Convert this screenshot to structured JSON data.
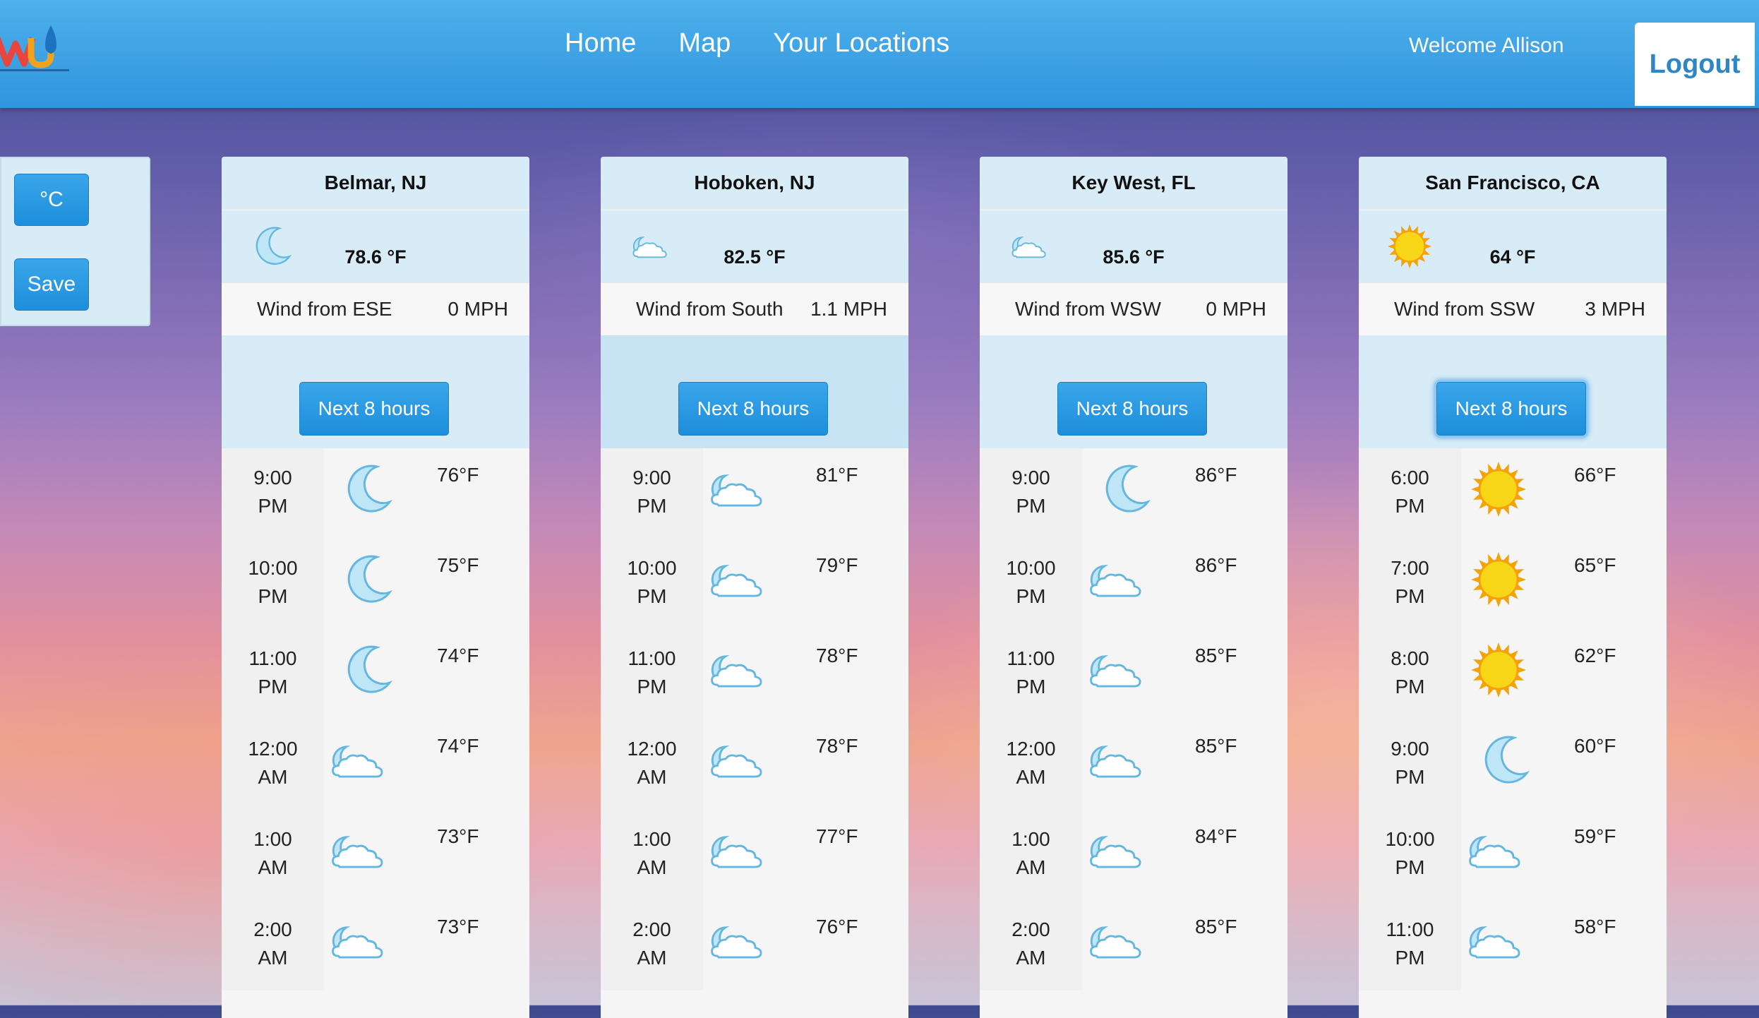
{
  "header": {
    "nav": [
      "Home",
      "Map",
      "Your Locations"
    ],
    "welcome": "Welcome Allison",
    "logout": "Logout"
  },
  "settings": {
    "unit_button": "°C",
    "save_button": "Save"
  },
  "colors": {
    "header": "#2f95dd",
    "button": "#1e8fdc",
    "card_panel": "#d8ecf7",
    "sun": "#f5c400",
    "moon": "#8fd0ee"
  },
  "cards": [
    {
      "title": "Belmar, NJ",
      "current_temp": "78.6 °F",
      "current_icon": "moon-icon",
      "wind_dir": "Wind from ESE",
      "wind_speed": "0 MPH",
      "button": "Next 8 hours",
      "hours": [
        {
          "time": "9:00 PM",
          "temp": "76°F",
          "icon": "moon-icon"
        },
        {
          "time": "10:00 PM",
          "temp": "75°F",
          "icon": "moon-icon"
        },
        {
          "time": "11:00 PM",
          "temp": "74°F",
          "icon": "moon-icon"
        },
        {
          "time": "12:00 AM",
          "temp": "74°F",
          "icon": "partly-cloudy-night-icon"
        },
        {
          "time": "1:00 AM",
          "temp": "73°F",
          "icon": "partly-cloudy-night-icon"
        },
        {
          "time": "2:00 AM",
          "temp": "73°F",
          "icon": "partly-cloudy-night-icon"
        }
      ]
    },
    {
      "title": "Hoboken, NJ",
      "current_temp": "82.5 °F",
      "current_icon": "partly-cloudy-night-icon",
      "wind_dir": "Wind from South",
      "wind_speed": "1.1 MPH",
      "button": "Next 8 hours",
      "hours": [
        {
          "time": "9:00 PM",
          "temp": "81°F",
          "icon": "partly-cloudy-night-icon"
        },
        {
          "time": "10:00 PM",
          "temp": "79°F",
          "icon": "partly-cloudy-night-icon"
        },
        {
          "time": "11:00 PM",
          "temp": "78°F",
          "icon": "partly-cloudy-night-icon"
        },
        {
          "time": "12:00 AM",
          "temp": "78°F",
          "icon": "partly-cloudy-night-icon"
        },
        {
          "time": "1:00 AM",
          "temp": "77°F",
          "icon": "partly-cloudy-night-icon"
        },
        {
          "time": "2:00 AM",
          "temp": "76°F",
          "icon": "partly-cloudy-night-icon"
        }
      ]
    },
    {
      "title": "Key West, FL",
      "current_temp": "85.6 °F",
      "current_icon": "partly-cloudy-night-icon",
      "wind_dir": "Wind from WSW",
      "wind_speed": "0 MPH",
      "button": "Next 8 hours",
      "hours": [
        {
          "time": "9:00 PM",
          "temp": "86°F",
          "icon": "moon-icon"
        },
        {
          "time": "10:00 PM",
          "temp": "86°F",
          "icon": "partly-cloudy-night-icon"
        },
        {
          "time": "11:00 PM",
          "temp": "85°F",
          "icon": "partly-cloudy-night-icon"
        },
        {
          "time": "12:00 AM",
          "temp": "85°F",
          "icon": "partly-cloudy-night-icon"
        },
        {
          "time": "1:00 AM",
          "temp": "84°F",
          "icon": "partly-cloudy-night-icon"
        },
        {
          "time": "2:00 AM",
          "temp": "85°F",
          "icon": "partly-cloudy-night-icon"
        }
      ]
    },
    {
      "title": "San Francisco, CA",
      "current_temp": "64 °F",
      "current_icon": "sun-icon",
      "wind_dir": "Wind from SSW",
      "wind_speed": "3 MPH",
      "button": "Next 8 hours",
      "hours": [
        {
          "time": "6:00 PM",
          "temp": "66°F",
          "icon": "sun-icon"
        },
        {
          "time": "7:00 PM",
          "temp": "65°F",
          "icon": "sun-icon"
        },
        {
          "time": "8:00 PM",
          "temp": "62°F",
          "icon": "sun-icon"
        },
        {
          "time": "9:00 PM",
          "temp": "60°F",
          "icon": "moon-icon"
        },
        {
          "time": "10:00 PM",
          "temp": "59°F",
          "icon": "partly-cloudy-night-icon"
        },
        {
          "time": "11:00 PM",
          "temp": "58°F",
          "icon": "partly-cloudy-night-icon"
        }
      ]
    }
  ]
}
